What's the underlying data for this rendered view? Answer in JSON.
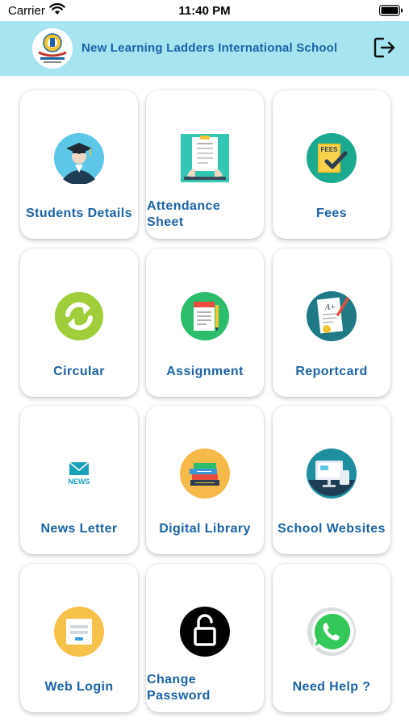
{
  "status_bar": {
    "carrier": "Carrier",
    "time": "11:40 PM"
  },
  "header": {
    "title": "New Learning Ladders International School",
    "logo_text": "NEW LEARNING LADDERS"
  },
  "tiles": [
    {
      "label": "Students Details",
      "icon": "student-icon"
    },
    {
      "label": "Attendance Sheet",
      "icon": "attendance-icon"
    },
    {
      "label": "Fees",
      "icon": "fees-icon",
      "icon_text": "FEES"
    },
    {
      "label": "Circular",
      "icon": "refresh-icon"
    },
    {
      "label": "Assignment",
      "icon": "assignment-icon"
    },
    {
      "label": "Reportcard",
      "icon": "reportcard-icon",
      "icon_text": "A+"
    },
    {
      "label": "News Letter",
      "icon": "news-icon",
      "icon_text": "NEWS"
    },
    {
      "label": "Digital Library",
      "icon": "books-icon"
    },
    {
      "label": "School Websites",
      "icon": "monitor-icon"
    },
    {
      "label": "Web Login",
      "icon": "web-login-icon"
    },
    {
      "label": "Change Password",
      "icon": "lock-icon"
    },
    {
      "label": "Need Help ?",
      "icon": "whatsapp-icon"
    }
  ],
  "colors": {
    "header_bg": "#a6e4f0",
    "label_blue": "#1b63a6"
  }
}
